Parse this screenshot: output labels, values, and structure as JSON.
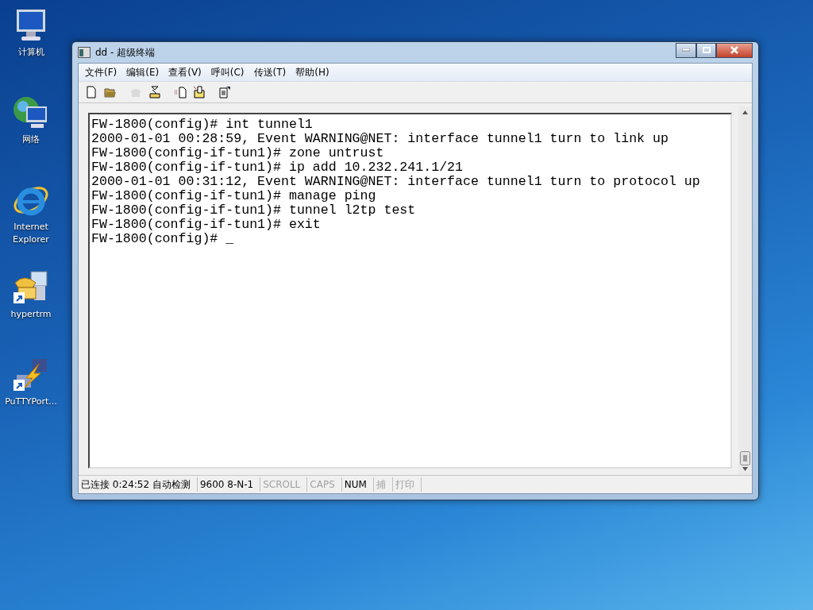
{
  "desktop_icons": [
    {
      "label": "计算机",
      "kind": "computer"
    },
    {
      "label": "网络",
      "kind": "network"
    },
    {
      "label": "Internet Explorer",
      "kind": "browser"
    },
    {
      "label": "hypertrm",
      "kind": "phone"
    },
    {
      "label": "PuTTYPort...",
      "kind": "bolt"
    }
  ],
  "window": {
    "title": "dd - 超级终端"
  },
  "menu": [
    "文件(F)",
    "编辑(E)",
    "查看(V)",
    "呼叫(C)",
    "传送(T)",
    "帮助(H)"
  ],
  "toolbar": [
    {
      "kind": "new",
      "disabled": false
    },
    {
      "kind": "open",
      "disabled": false
    },
    {
      "kind": "call",
      "disabled": true
    },
    {
      "kind": "hangup",
      "disabled": false
    },
    {
      "kind": "send",
      "disabled": false
    },
    {
      "kind": "receive",
      "disabled": false
    },
    {
      "kind": "properties",
      "disabled": false
    }
  ],
  "terminal": {
    "lines": [
      "FW-1800(config)# int tunnel1",
      "2000-01-01 00:28:59, Event WARNING@NET: interface tunnel1 turn to link up",
      "FW-1800(config-if-tun1)# zone untrust",
      "FW-1800(config-if-tun1)# ip add 10.232.241.1/21",
      "2000-01-01 00:31:12, Event WARNING@NET: interface tunnel1 turn to protocol up",
      "FW-1800(config-if-tun1)# manage ping",
      "FW-1800(config-if-tun1)# tunnel l2tp test",
      "FW-1800(config-if-tun1)# exit",
      "FW-1800(config)# _"
    ]
  },
  "status_bar": [
    {
      "text": "已连接 0:24:52 自动检测",
      "disabled": false
    },
    {
      "text": "9600 8-N-1",
      "disabled": false
    },
    {
      "text": "SCROLL",
      "disabled": true
    },
    {
      "text": "CAPS",
      "disabled": true
    },
    {
      "text": "NUM",
      "disabled": false
    },
    {
      "text": "捕",
      "disabled": true
    },
    {
      "text": "打印",
      "disabled": true
    }
  ]
}
